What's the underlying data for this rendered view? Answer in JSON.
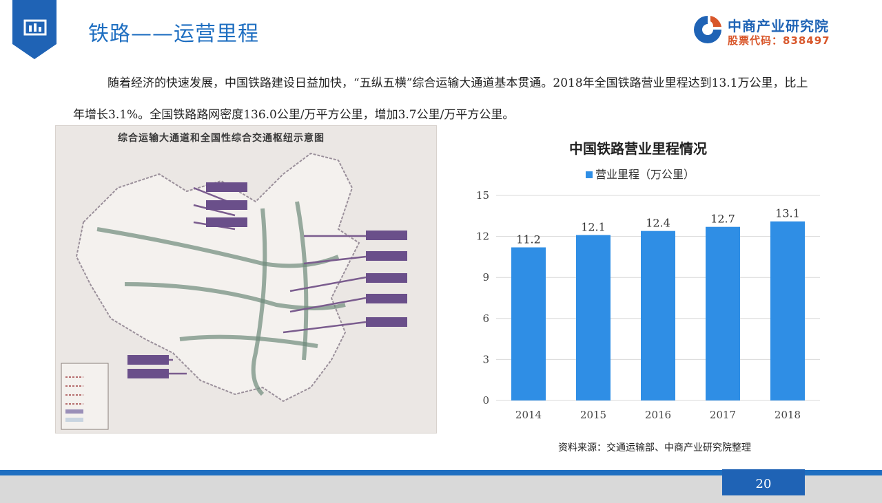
{
  "header": {
    "title": "铁路——运营里程",
    "brand_name": "中商产业研究院",
    "stock_code": "股票代码：838497"
  },
  "intro": {
    "text": "随着经济的快速发展，中国铁路建设日益加快，“五纵五横”综合运输大通道基本贯通。2018年全国铁路营业里程达到13.1万公里，比上年增长3.1%。全国铁路路网密度136.0公里/万平方公里，增加3.7公里/万平方公里。"
  },
  "map": {
    "title": "综合运输大通道和全国性综合交通枢纽示意图"
  },
  "colors": {
    "accent": "#1f6fc1",
    "bar": "#2f8ee5",
    "logo_orange": "#d8562a"
  },
  "chart_data": {
    "type": "bar",
    "title": "中国铁路营业里程情况",
    "categories": [
      "2014",
      "2015",
      "2016",
      "2017",
      "2018"
    ],
    "series": [
      {
        "name": "营业里程（万公里）",
        "values": [
          11.2,
          12.1,
          12.4,
          12.7,
          13.1
        ]
      }
    ],
    "ylim": [
      0,
      15
    ],
    "yticks": [
      0,
      3,
      6,
      9,
      12,
      15
    ],
    "data_labels": [
      "11.2",
      "12.1",
      "12.4",
      "12.7",
      "13.1"
    ],
    "grid": true,
    "legend": "top"
  },
  "source": "资料来源：交通运输部、中商产业研究院整理",
  "footer": {
    "page_number": "20"
  }
}
